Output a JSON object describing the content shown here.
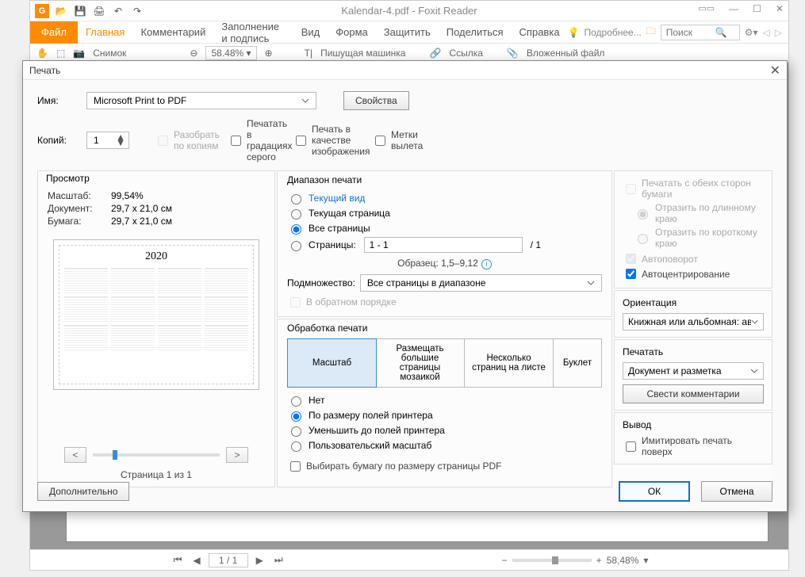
{
  "app": {
    "title": "Kalendar-4.pdf - Foxit Reader",
    "file_tab": "Файл",
    "ribbon_tabs": [
      "Главная",
      "Комментарий",
      "Заполнение и подпись",
      "Вид",
      "Форма",
      "Защитить",
      "Поделиться",
      "Справка"
    ],
    "more": "Подробнее...",
    "search_placeholder": "Поиск",
    "toolbar2": {
      "snapshot": "Снимок",
      "zoom": "58.48%",
      "typewriter": "Пишущая машинка",
      "link": "Ссылка",
      "attach": "Вложенный файл"
    },
    "status": {
      "page": "1 / 1",
      "zoom": "58,48%"
    }
  },
  "dialog": {
    "title": "Печать",
    "name_label": "Имя:",
    "printer": "Microsoft Print to PDF",
    "properties_btn": "Свойства",
    "copies_label": "Копий:",
    "copies_value": "1",
    "collate": "Разобрать по копиям",
    "grayscale": "Печатать в градациях серого",
    "as_image": "Печать в качестве изображения",
    "print_marks": "Метки вылета",
    "preview": {
      "title": "Просмотр",
      "scale_label": "Масштаб:",
      "scale_value": "99,54%",
      "doc_label": "Документ:",
      "doc_value": "29,7 x 21,0 см",
      "paper_label": "Бумага:",
      "paper_value": "29,7 x 21,0 см",
      "year": "2020",
      "page_of": "Страница 1 из 1"
    },
    "range": {
      "title": "Диапазон печати",
      "current_view": "Текущий вид",
      "current_page": "Текущая страница",
      "all_pages": "Все страницы",
      "pages_label": "Страницы:",
      "pages_value": "1 - 1",
      "pages_total": "/ 1",
      "sample": "Образец: 1,5–9,12",
      "subset_label": "Подмножество:",
      "subset_value": "Все страницы в диапазоне",
      "reverse": "В обратном порядке"
    },
    "duplex": {
      "both_sides": "Печатать с обеих сторон бумаги",
      "flip_long": "Отразить по длинному краю",
      "flip_short": "Отразить по короткому краю",
      "auto_rotate": "Автоповорот",
      "auto_center": "Автоцентрирование"
    },
    "handling": {
      "title": "Обработка печати",
      "tabs": [
        "Масштаб",
        "Размещать большие страницы мозаикой",
        "Несколько страниц на листе",
        "Буклет"
      ],
      "none": "Нет",
      "fit_margins": "По размеру полей принтера",
      "shrink_margins": "Уменьшить до полей принтера",
      "custom_scale": "Пользовательский масштаб",
      "choose_paper": "Выбирать бумагу по размеру страницы PDF"
    },
    "orientation": {
      "title": "Ориентация",
      "value": "Книжная или альбомная: авто"
    },
    "what": {
      "title": "Печатать",
      "value": "Документ и разметка",
      "summarize": "Свести комментарии"
    },
    "output": {
      "title": "Вывод",
      "simulate": "Имитировать печать поверх"
    },
    "advanced_btn": "Дополнительно",
    "ok_btn": "ОК",
    "cancel_btn": "Отмена"
  }
}
